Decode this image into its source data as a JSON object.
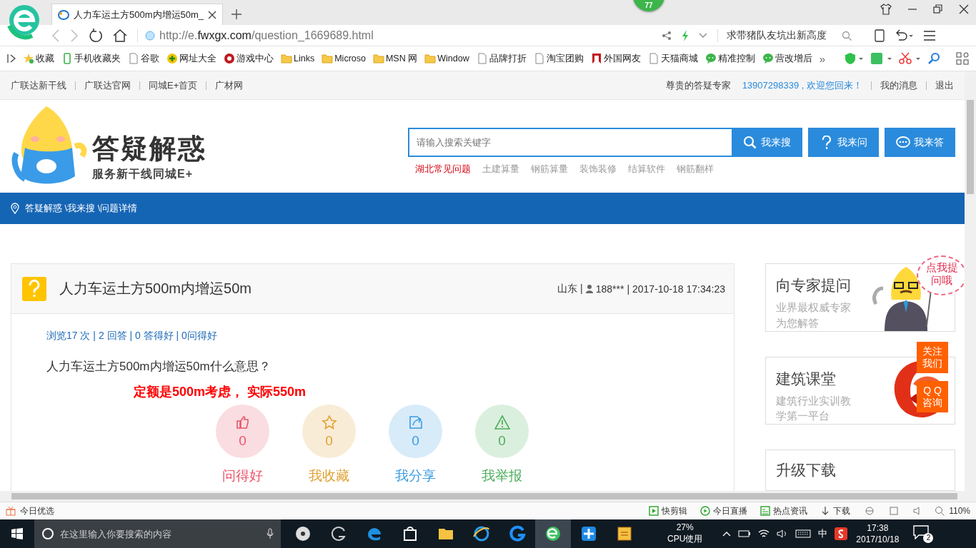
{
  "browser": {
    "tab": {
      "title": "人力车运土方500m内增运50m_"
    },
    "badge": "77",
    "url": {
      "scheme": "http://e.",
      "domain": "fwxgx.com",
      "path": "/question_1669689.html"
    },
    "search": {
      "value": "求带猪队友坑出新高度"
    },
    "bookmarks": [
      {
        "label": "收藏",
        "kind": "star"
      },
      {
        "label": "手机收藏夹",
        "kind": "phone"
      },
      {
        "label": "谷歌",
        "kind": "page"
      },
      {
        "label": "网址大全",
        "kind": "plus"
      },
      {
        "label": "游戏中心",
        "kind": "game"
      },
      {
        "label": "Links",
        "kind": "folder"
      },
      {
        "label": "Microso",
        "kind": "folder"
      },
      {
        "label": "MSN 网",
        "kind": "folder"
      },
      {
        "label": "Window",
        "kind": "folder"
      },
      {
        "label": "品牌打折",
        "kind": "page"
      },
      {
        "label": "淘宝团购",
        "kind": "page"
      },
      {
        "label": "外国网友",
        "kind": "flag"
      },
      {
        "label": "天猫商城",
        "kind": "page"
      },
      {
        "label": "精准控制",
        "kind": "chat"
      },
      {
        "label": "营改增后",
        "kind": "chat"
      }
    ],
    "more": "»"
  },
  "site": {
    "top_links": [
      "广联达新干线",
      "广联达官网",
      "同城E+首页",
      "广材网"
    ],
    "user": {
      "role": "尊贵的答疑专家",
      "greeting": "13907298339 , 欢迎您回来！",
      "messages": "我的消息",
      "logout": "退出"
    },
    "logo": {
      "title": "答疑解惑",
      "subtitle": "服务新干线同城E+"
    },
    "search": {
      "placeholder": "请输入搜索关键字"
    },
    "buttons": [
      {
        "label": "我来搜",
        "kind": "search"
      },
      {
        "label": "我来问",
        "kind": "ask"
      },
      {
        "label": "我来答",
        "kind": "answer"
      }
    ],
    "hot_tags": [
      {
        "label": "湖北常见问题",
        "hot": true
      },
      {
        "label": "土建算量",
        "hot": false
      },
      {
        "label": "钢筋算量",
        "hot": false
      },
      {
        "label": "装饰装修",
        "hot": false
      },
      {
        "label": "结算软件",
        "hot": false
      },
      {
        "label": "钢筋翻样",
        "hot": false
      }
    ],
    "breadcrumb": "答疑解惑 \\我来搜 \\问题详情"
  },
  "question": {
    "title": "人力车运土方500m内增运50m",
    "region": "山东 |",
    "user": "188***",
    "time": "| 2017-10-18 17:34:23",
    "stats": "浏览17 次 | 2 回答 | 0 答得好 | 0问得好",
    "body": "人力车运土方500m内增运50m什么意思？",
    "answer": "定额是500m考虑， 实际550m",
    "actions": [
      {
        "kind": "like",
        "count": "0",
        "label": "问得好",
        "color": "#e8546a"
      },
      {
        "kind": "favorite",
        "count": "0",
        "label": "我收藏",
        "color": "#e0a030"
      },
      {
        "kind": "share",
        "count": "0",
        "label": "我分享",
        "color": "#3a9be0"
      },
      {
        "kind": "report",
        "count": "0",
        "label": "我举报",
        "color": "#4cae5c"
      }
    ]
  },
  "sidebar": {
    "cards": [
      {
        "title": "向专家提问",
        "desc": "业界最权威专家为您解答",
        "kind": "expert"
      },
      {
        "title": "建筑课堂",
        "desc": "建筑行业实训教学第一平台",
        "kind": "school"
      },
      {
        "title": "升级下载",
        "kind": "plain"
      }
    ],
    "bubble": "点我提问哦",
    "float_buttons": [
      "关注我们",
      "Q Q 咨询"
    ]
  },
  "status_bar": {
    "left": "今日优选",
    "items": [
      {
        "label": "快剪辑",
        "kind": "play"
      },
      {
        "label": "今日直播",
        "kind": "live"
      },
      {
        "label": "热点资讯",
        "kind": "news"
      },
      {
        "label": "下载",
        "kind": "download"
      }
    ],
    "zoom": "110%"
  },
  "taskbar": {
    "search": {
      "placeholder": "在这里输入你要搜索的内容"
    },
    "cpu": "27%",
    "cpu_label": "CPU使用",
    "ime": "中",
    "time": "17:38",
    "date": "2017/10/18",
    "notifications": "2"
  }
}
